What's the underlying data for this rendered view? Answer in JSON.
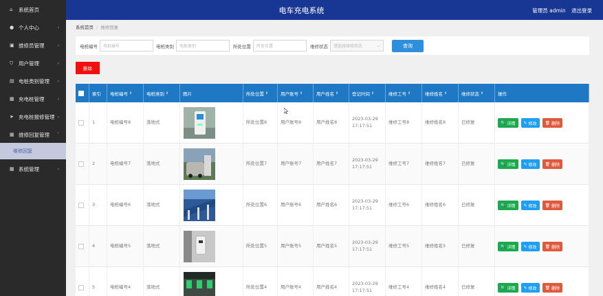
{
  "header": {
    "title": "电车充电系统",
    "user": "管理员 admin",
    "logout": "退出登录"
  },
  "sidebar": {
    "items": [
      {
        "label": "系统首页",
        "icon": "home-icon",
        "glyph": "⌂"
      },
      {
        "label": "个人中心",
        "icon": "user-icon",
        "glyph": "●",
        "arrow": "›"
      },
      {
        "label": "维修员管理",
        "icon": "briefcase-icon",
        "glyph": "▣",
        "arrow": "›"
      },
      {
        "label": "用户管理",
        "icon": "shield-icon",
        "glyph": "⛉",
        "arrow": "›"
      },
      {
        "label": "电桩类别管理",
        "icon": "box-icon",
        "glyph": "▤",
        "arrow": "›"
      },
      {
        "label": "充电桩管理",
        "icon": "grid-icon",
        "glyph": "▦",
        "arrow": "›"
      },
      {
        "label": "充电桩报修管理",
        "icon": "send-icon",
        "glyph": "➤",
        "arrow": "›"
      },
      {
        "label": "维修回复管理",
        "icon": "grid-icon",
        "glyph": "▦",
        "arrow": "ˇ"
      },
      {
        "label": "系统管理",
        "icon": "grid-icon",
        "glyph": "▦",
        "arrow": "›"
      }
    ],
    "sub_item": "维修回复"
  },
  "breadcrumb": {
    "home": "系统首页",
    "sep": "/",
    "current": "维修回复"
  },
  "search": {
    "fields": [
      {
        "label": "电桩编号",
        "placeholder": "电桩编号"
      },
      {
        "label": "电桩类别",
        "placeholder": "电桩类别"
      },
      {
        "label": "所处位置",
        "placeholder": "所处位置"
      }
    ],
    "status": {
      "label": "维修状态",
      "placeholder": "请选择维修状态",
      "chevron": "⌄"
    },
    "button": "查询"
  },
  "delete_all": "删除",
  "table": {
    "headers": [
      "",
      "索引",
      "电桩编号",
      "电桩类别",
      "图片",
      "所处位置",
      "用户账号",
      "用户姓名",
      "登记时间",
      "维修工号",
      "维修姓名",
      "维修状态",
      "操作"
    ],
    "sort_mark": "⇕",
    "actions": {
      "detail": "详情",
      "edit": "修改",
      "remove": "删除",
      "detail_glyph": "🔍",
      "edit_glyph": "✎",
      "remove_glyph": "🗑"
    },
    "rows": [
      {
        "index": "1",
        "code": "电桩编号8",
        "type": "落地式",
        "location": "所处位置8",
        "account": "用户账号8",
        "name": "用户姓名8",
        "time": "2023-03-29 17:17:51",
        "worker_id": "维修工号8",
        "worker_name": "维修姓名8",
        "status": "已修复",
        "img": "charger-white"
      },
      {
        "index": "2",
        "code": "电桩编号7",
        "type": "落地式",
        "location": "所处位置7",
        "account": "用户账号7",
        "name": "用户姓名7",
        "time": "2023-03-29 17:17:51",
        "worker_id": "维修工号7",
        "worker_name": "维修姓名7",
        "status": "已修复",
        "img": "charging-car"
      },
      {
        "index": "3",
        "code": "电桩编号6",
        "type": "落地式",
        "location": "所处位置6",
        "account": "用户账号6",
        "name": "用户姓名6",
        "time": "2023-03-29 17:17:51",
        "worker_id": "维修工号6",
        "worker_name": "维修姓名6",
        "status": "已修复",
        "img": "solar-station"
      },
      {
        "index": "4",
        "code": "电桩编号5",
        "type": "落地式",
        "location": "所处位置5",
        "account": "用户账号5",
        "name": "用户姓名5",
        "time": "2023-03-29 17:17:51",
        "worker_id": "维修工号5",
        "worker_name": "维修姓名5",
        "status": "已修复",
        "img": "wall-charger"
      },
      {
        "index": "5",
        "code": "电桩编号4",
        "type": "落地式",
        "location": "所处位置4",
        "account": "用户账号4",
        "name": "用户姓名4",
        "time": "2023-03-29 17:17:51",
        "worker_id": "维修工号4",
        "worker_name": "维修姓名4",
        "status": "已修复",
        "img": "garage"
      }
    ]
  },
  "colors": {
    "header": "#183693",
    "sidebar": "#2a2a2a",
    "table_head": "#1e78c4",
    "search_btn": "#2f8fdd",
    "delete": "#f01010",
    "detail": "#1aa94d",
    "edit": "#1e9ff2",
    "remove": "#e0593c"
  }
}
